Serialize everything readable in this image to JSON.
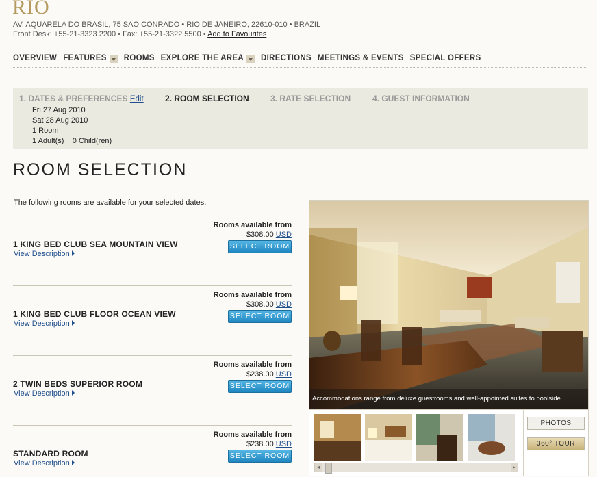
{
  "hotel": {
    "logo": "RIO",
    "address_line": "AV. AQUARELA DO BRASIL, 75 SAO CONRADO • RIO DE JANEIRO, 22610-010 • BRAZIL",
    "contact_line": "Front Desk: +55-21-3323 2200 • Fax: +55-21-3322 5500 • ",
    "favourites_link": "Add to Favourites"
  },
  "nav": {
    "overview": "OVERVIEW",
    "features": "FEATURES",
    "rooms": "ROOMS",
    "explore": "EXPLORE THE AREA",
    "directions": "DIRECTIONS",
    "meetings": "MEETINGS & EVENTS",
    "offers": "SPECIAL OFFERS"
  },
  "steps": {
    "step1": "1. DATES & PREFERENCES",
    "edit": "Edit",
    "step2": "2. ROOM SELECTION",
    "step3": "3. RATE SELECTION",
    "step4": "4. GUEST INFORMATION",
    "checkin": "Fri 27 Aug 2010",
    "checkout": "Sat 28 Aug 2010",
    "rooms": "1 Room",
    "guests": "1 Adult(s)    0 Child(ren)"
  },
  "page": {
    "title": "ROOM SELECTION",
    "intro": "The following rooms are available for your selected dates."
  },
  "rooms": [
    {
      "name": "1 KING BED CLUB SEA MOUNTAIN VIEW",
      "view": "View Description",
      "avail": "Rooms available from",
      "price": "$308.00",
      "currency": "USD",
      "button": "SELECT ROOM"
    },
    {
      "name": "1 KING BED CLUB FLOOR OCEAN VIEW",
      "view": "View Description",
      "avail": "Rooms available from",
      "price": "$308.00",
      "currency": "USD",
      "button": "SELECT ROOM"
    },
    {
      "name": "2 TWIN BEDS SUPERIOR ROOM",
      "view": "View Description",
      "avail": "Rooms available from",
      "price": "$238.00",
      "currency": "USD",
      "button": "SELECT ROOM"
    },
    {
      "name": "STANDARD ROOM",
      "view": "View Description",
      "avail": "Rooms available from",
      "price": "$238.00",
      "currency": "USD",
      "button": "SELECT ROOM"
    }
  ],
  "gallery": {
    "caption": "Accommodations range from deluxe guestrooms and well-appointed suites to poolside cabanas.",
    "photos_button": "PHOTOS",
    "tour_button": "360° TOUR"
  },
  "colors": {
    "gold": "#b49a5e",
    "link": "#1f4e8c",
    "button": "#1f86c0"
  }
}
